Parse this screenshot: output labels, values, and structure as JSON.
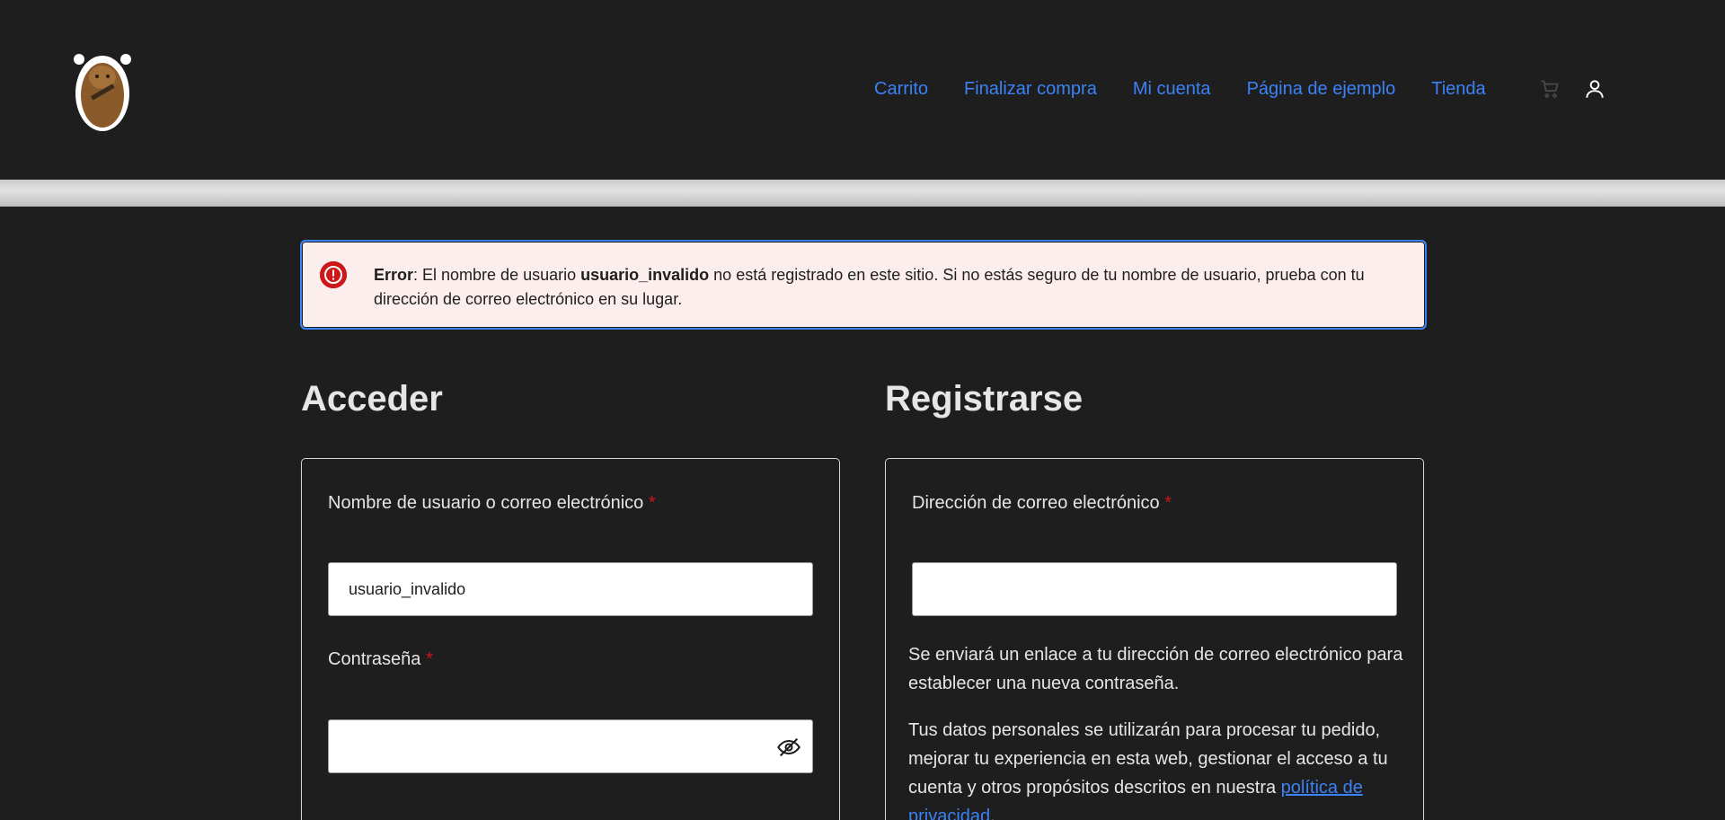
{
  "header": {
    "logo_alt": "logo",
    "nav": [
      "Carrito",
      "Finalizar compra",
      "Mi cuenta",
      "Página de ejemplo",
      "Tienda"
    ],
    "icons": [
      "cart-icon",
      "account-icon"
    ]
  },
  "notice": {
    "label": "Error",
    "before_user": ": El nombre de usuario ",
    "username": "usuario_invalido",
    "after_user": " no está registrado en este sitio. Si no estás seguro de tu nombre de usuario, prueba con tu dirección de correo electrónico en su lugar."
  },
  "login": {
    "title": "Acceder",
    "username_label": "Nombre de usuario o correo electrónico",
    "username_value": "usuario_invalido",
    "password_label": "Contraseña",
    "required_mark": "*"
  },
  "register": {
    "title": "Registrarse",
    "email_label": "Dirección de correo electrónico",
    "required_mark": "*",
    "email_value": "",
    "info": "Se enviará un enlace a tu dirección de correo electrónico para establecer una nueva contraseña.",
    "privacy_text": "Tus datos personales se utilizarán para procesar tu pedido, mejorar tu experiencia en esta web, gestionar el acceso a tu cuenta y otros propósitos descritos en nuestra ",
    "privacy_link": "política de privacidad",
    "privacy_end": "."
  },
  "colors": {
    "background": "#1e1e1f",
    "link": "#3b82f6",
    "error_bg": "#fdeeee",
    "error_icon": "#cc1818"
  }
}
